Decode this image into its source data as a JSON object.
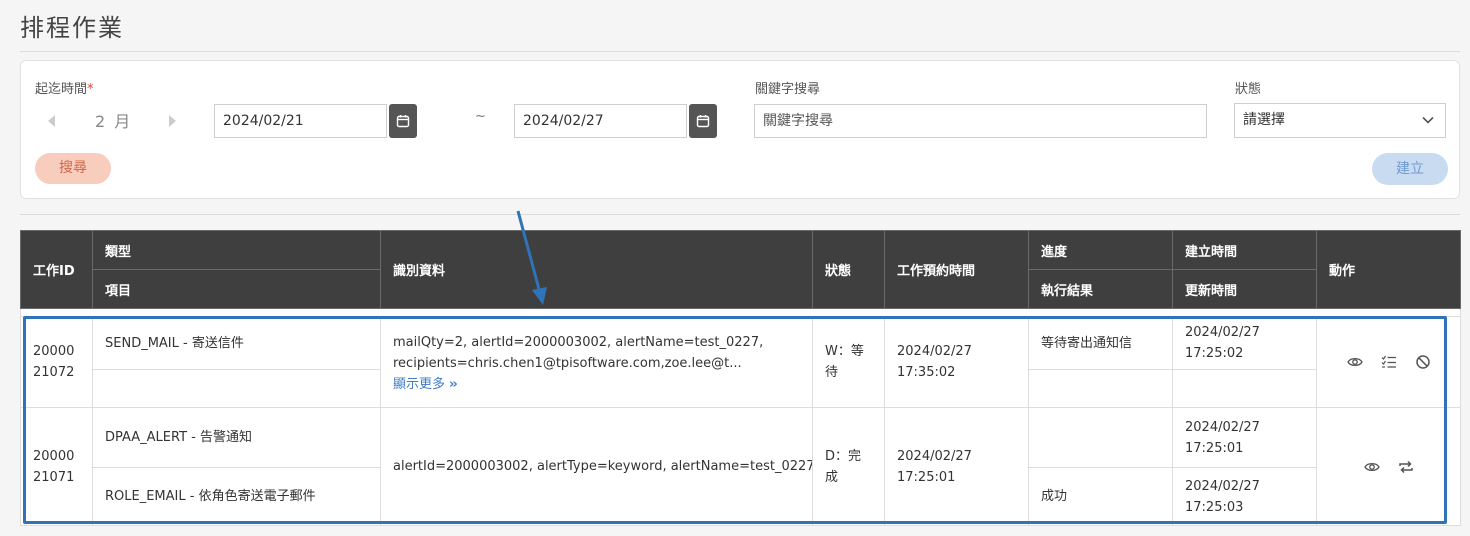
{
  "page": {
    "title": "排程作業"
  },
  "filters": {
    "time_label": "起迄時間",
    "required_mark": "*",
    "month": "2 月",
    "start_date": "2024/02/21",
    "separator": "~",
    "end_date": "2024/02/27",
    "keyword_label": "關鍵字搜尋",
    "keyword_placeholder": "關鍵字搜尋",
    "status_label": "狀態",
    "status_value": "請選擇",
    "search_button": "搜尋",
    "create_button": "建立"
  },
  "table": {
    "headers": {
      "job_id": "工作ID",
      "type": "類型",
      "item": "項目",
      "identity": "識別資料",
      "status": "狀態",
      "scheduled_time": "工作預約時間",
      "progress": "進度",
      "result": "執行結果",
      "created_time": "建立時間",
      "updated_time": "更新時間",
      "actions": "動作"
    },
    "rows": [
      {
        "job_id": "2000021072",
        "type": "SEND_MAIL - 寄送信件",
        "item": "",
        "identity_line1": "mailQty=2,    alertId=2000003002,    alertName=test_0227,",
        "identity_line2": "recipients=chris.chen1@tpisoftware.com,zoe.lee@t...",
        "show_more": "顯示更多",
        "status": "W：等待",
        "scheduled_time": "2024/02/27 17:35:02",
        "progress": "等待寄出通知信",
        "result": "",
        "created_time": "2024/02/27 17:25:02",
        "updated_time": ""
      },
      {
        "job_id": "2000021071",
        "type": "DPAA_ALERT - 告警通知",
        "item": "ROLE_EMAIL - 依角色寄送電子郵件",
        "identity": "alertId=2000003002, alertType=keyword, alertName=test_0227",
        "status": "D：完成",
        "scheduled_time": "2024/02/27 17:25:01",
        "progress": "",
        "result": "成功",
        "created_time": "2024/02/27 17:25:01",
        "updated_time": "2024/02/27 17:25:03"
      }
    ]
  },
  "colors": {
    "header_bg": "#3f3f3f",
    "highlight": "#2f73b8",
    "search_button_bg": "#f8cdbd",
    "create_button_bg": "#c9dbf1"
  },
  "icons": {
    "calendar": "calendar-icon",
    "chevron": "chevron-down-icon",
    "view": "eye-icon",
    "list": "checklist-icon",
    "cancel": "ban-icon",
    "retry": "repeat-icon"
  }
}
